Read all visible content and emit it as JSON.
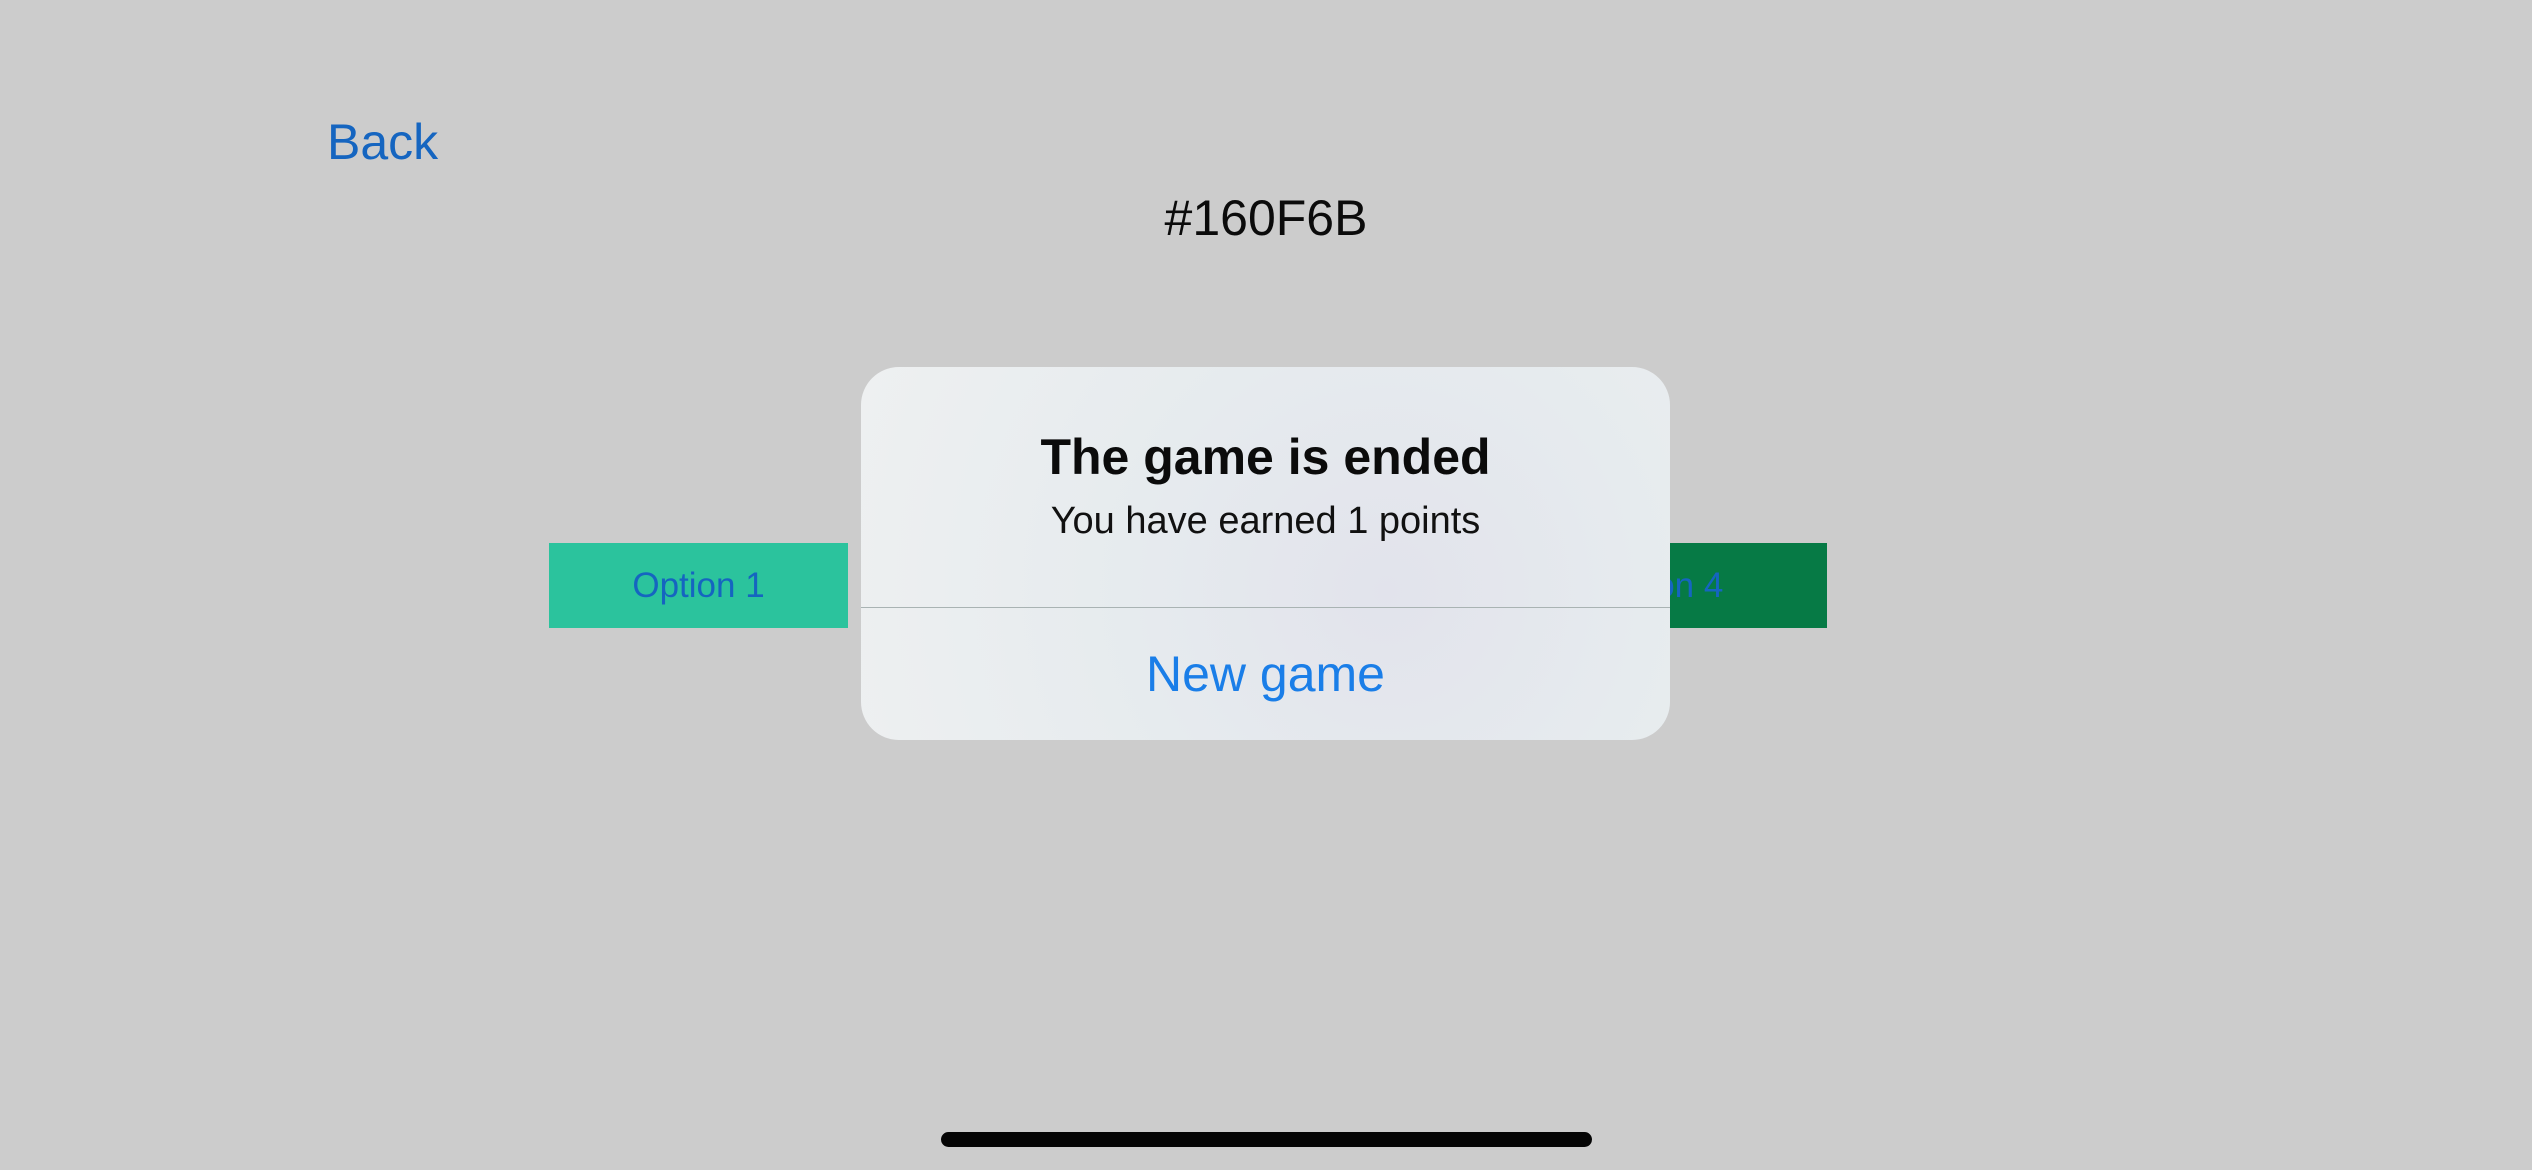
{
  "nav": {
    "back_label": "Back"
  },
  "game": {
    "color_code": "#160F6B",
    "options": [
      {
        "label": "Option 1",
        "color": "#2bc39d"
      },
      {
        "label": "tion 4",
        "color": "#067a45"
      }
    ]
  },
  "alert": {
    "title": "The game is ended",
    "message": "You have earned 1 points",
    "action_label": "New game"
  },
  "colors": {
    "background": "#cccccc",
    "link": "#1565c0",
    "alert_action": "#1a7ee8"
  }
}
